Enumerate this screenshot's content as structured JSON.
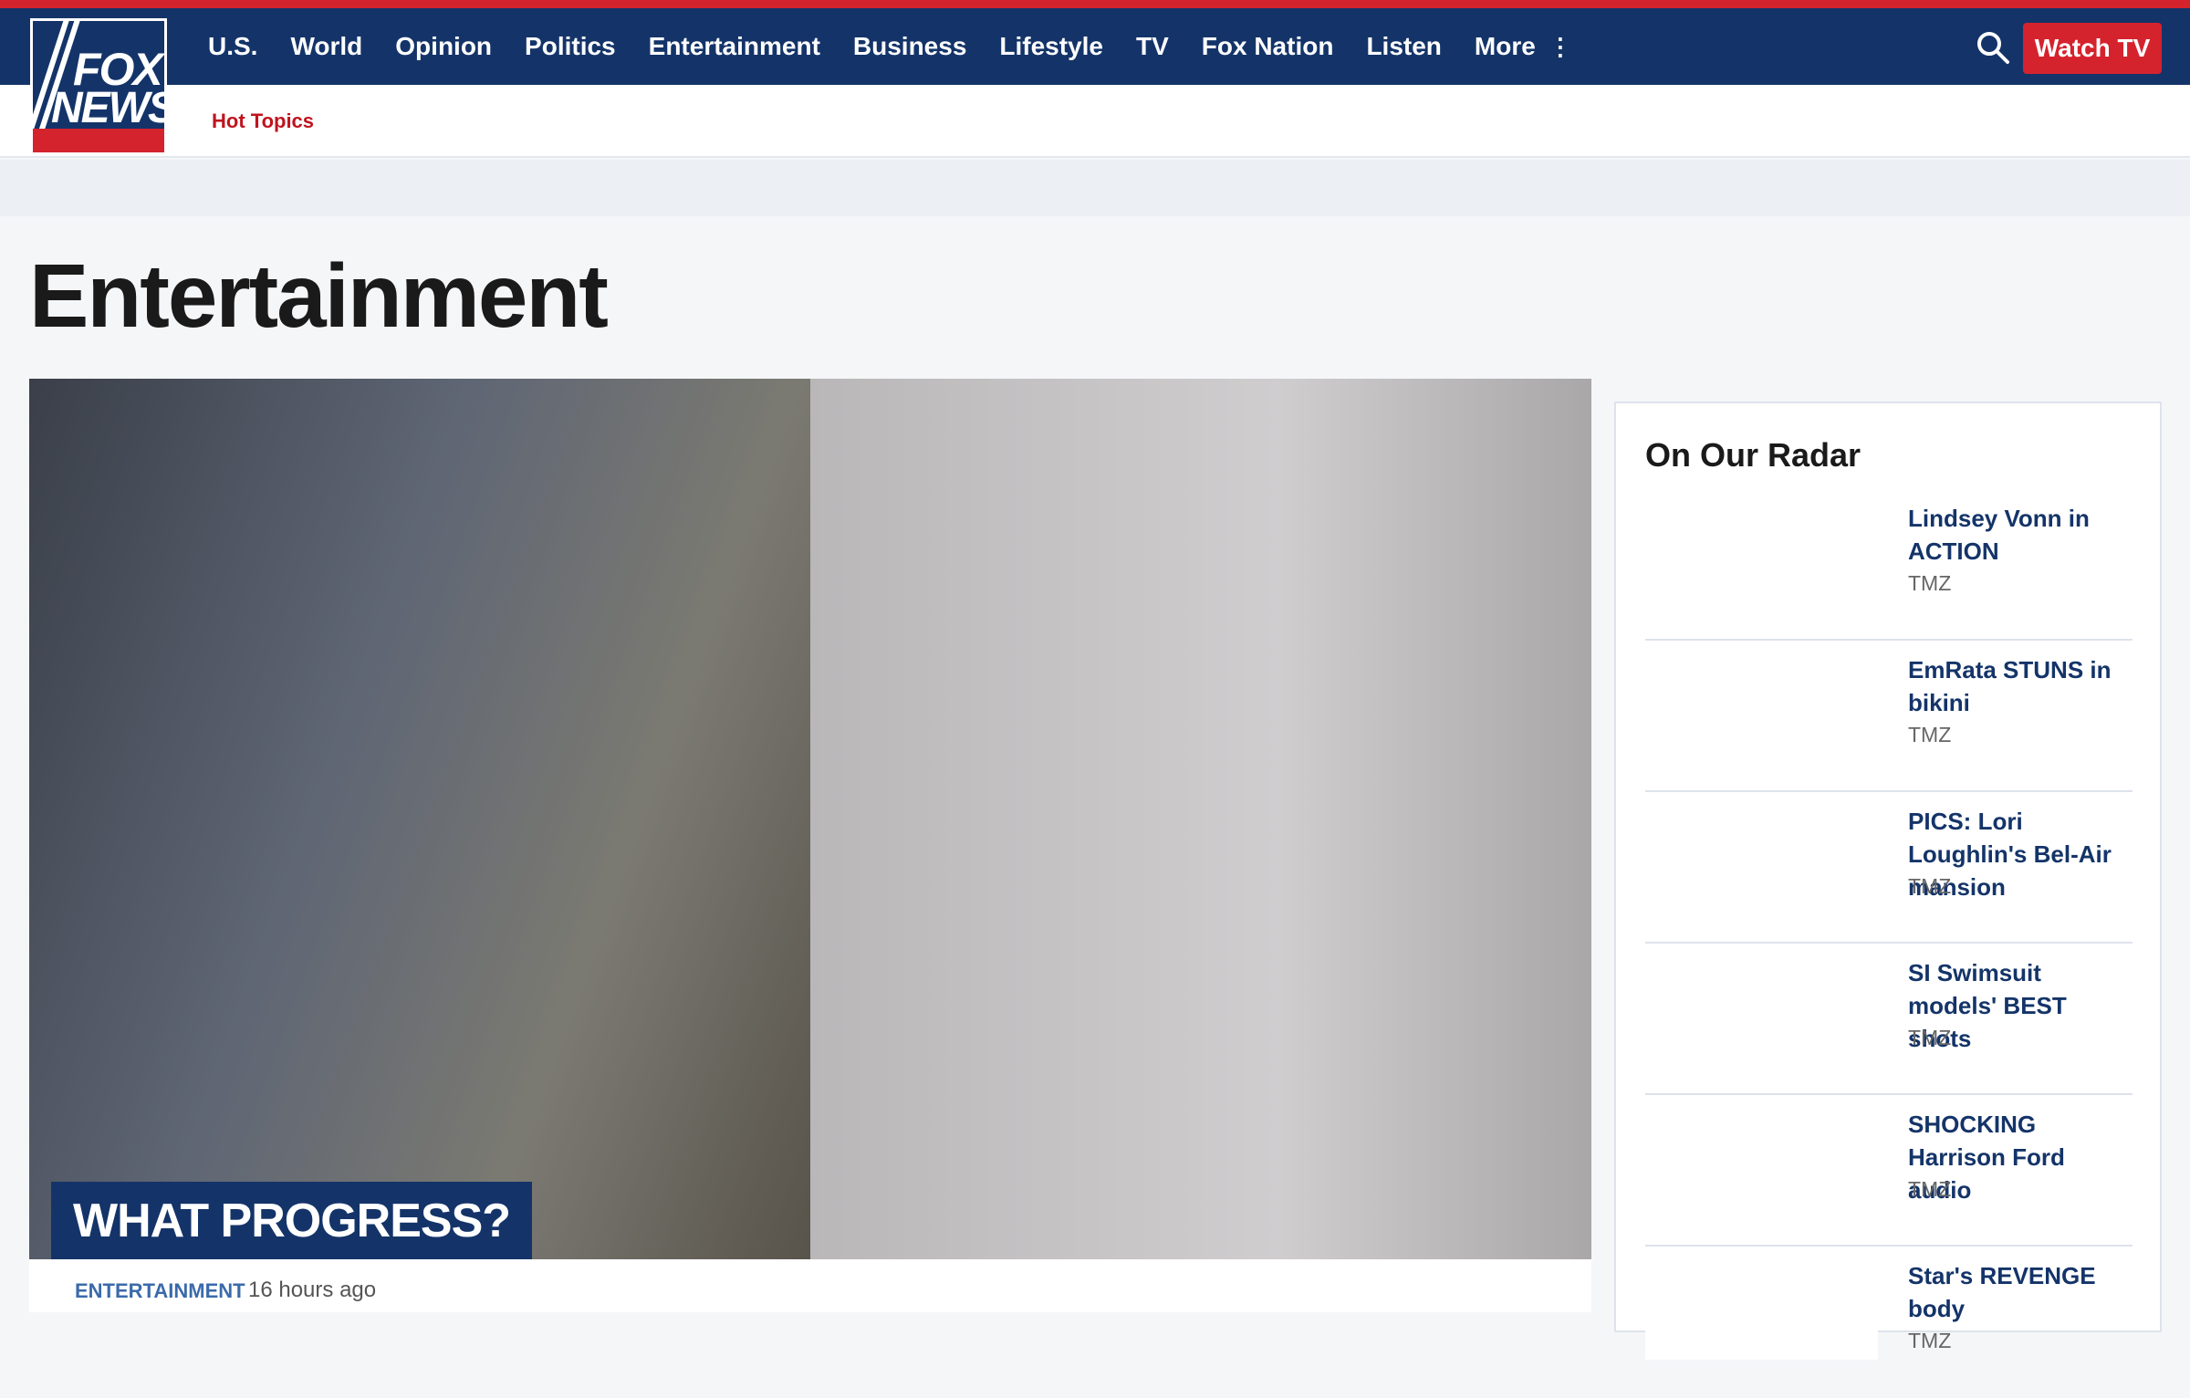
{
  "header": {
    "logo_text": [
      "FOX",
      "NEWS"
    ],
    "nav": [
      "U.S.",
      "World",
      "Opinion",
      "Politics",
      "Entertainment",
      "Business",
      "Lifestyle",
      "TV",
      "Fox Nation",
      "Listen",
      "More"
    ],
    "more_icon": "vertical-dots-icon",
    "search_icon": "search-icon",
    "watch_tv": "Watch TV",
    "hot_topics": "Hot Topics",
    "colors": {
      "navy": "#143469",
      "red": "#d5232d"
    }
  },
  "page": {
    "title": "Entertainment"
  },
  "hero": {
    "caption": "WHAT PROGRESS?",
    "category": "ENTERTAINMENT",
    "time": "16 hours ago"
  },
  "radar": {
    "title": "On Our Radar",
    "items": [
      {
        "headline": "Lindsey Vonn in ACTION",
        "source": "TMZ"
      },
      {
        "headline": "EmRata STUNS in bikini",
        "source": "TMZ"
      },
      {
        "headline": "PICS: Lori Loughlin's Bel-Air mansion",
        "source": "TMZ"
      },
      {
        "headline": "SI Swimsuit models' BEST shots",
        "source": "TMZ"
      },
      {
        "headline": "SHOCKING Harrison Ford audio",
        "source": "TMZ"
      },
      {
        "headline": "Star's REVENGE body",
        "source": "TMZ"
      }
    ]
  }
}
